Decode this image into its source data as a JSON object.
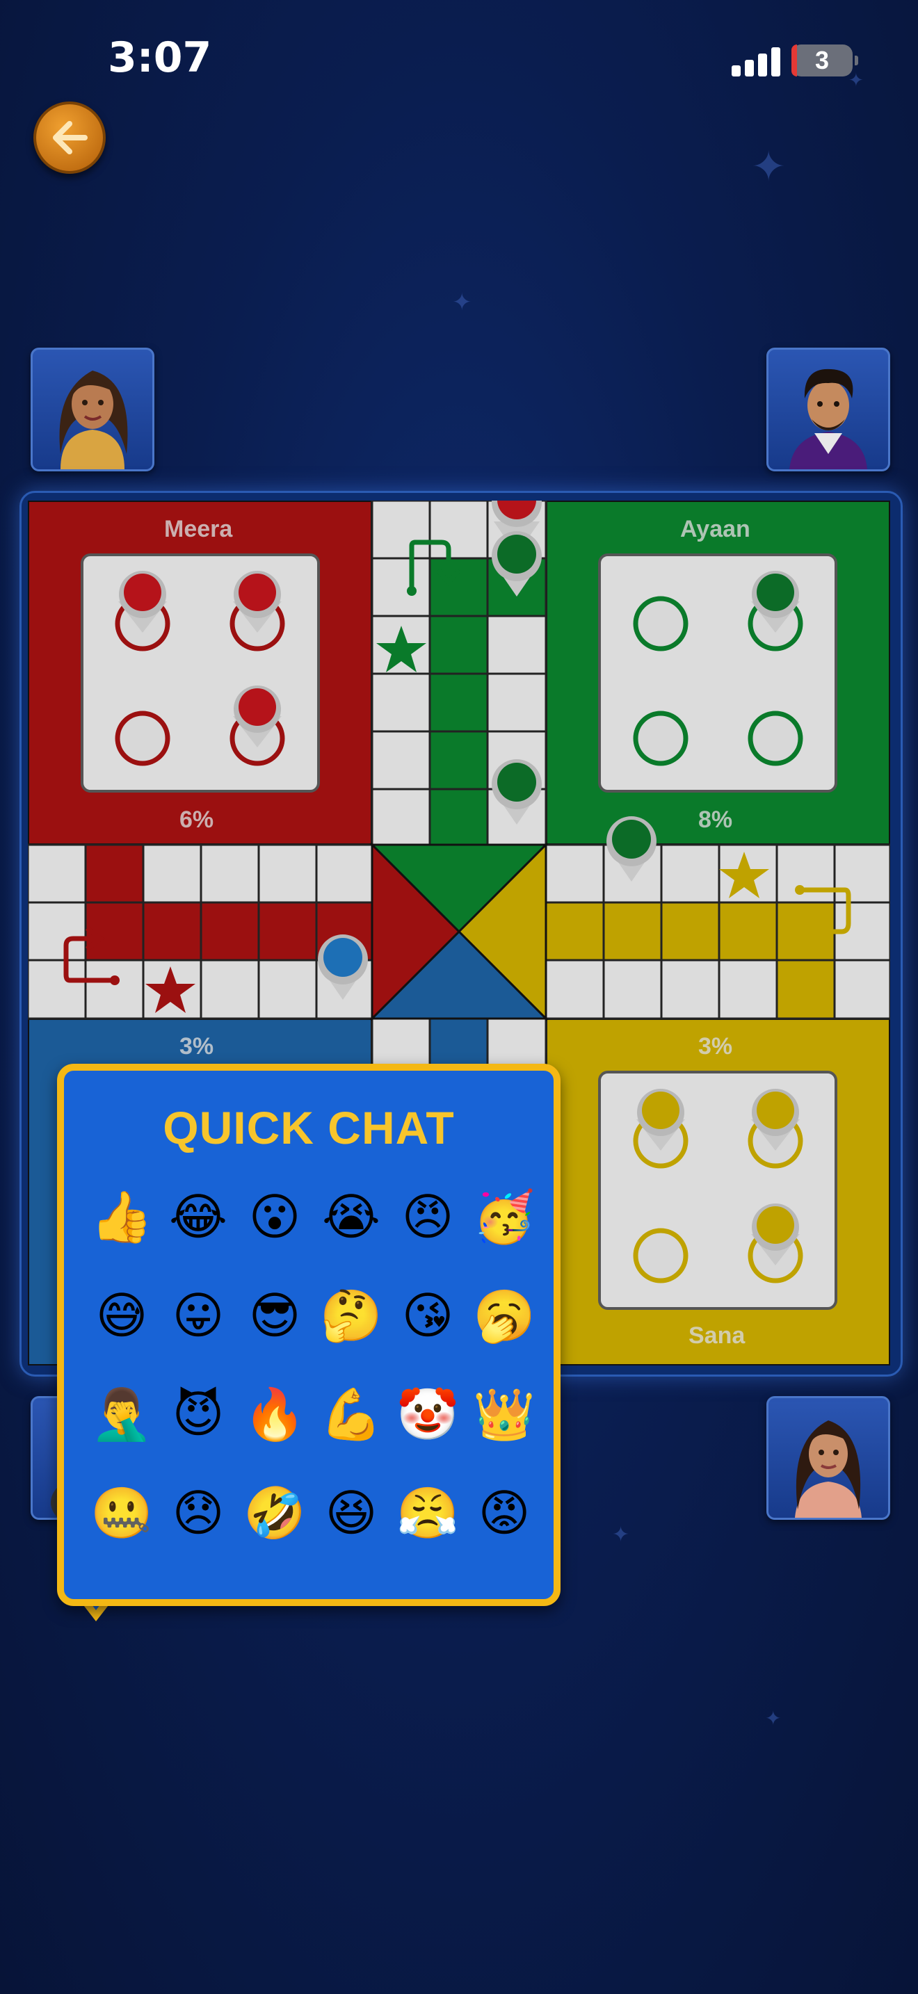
{
  "status_bar": {
    "time": "3:07",
    "battery": "3"
  },
  "players": {
    "red": {
      "name": "Meera",
      "progress": "6%"
    },
    "green": {
      "name": "Ayaan",
      "progress": "8%"
    },
    "blue": {
      "progress": "3%"
    },
    "yellow": {
      "name": "Sana",
      "progress": "3%"
    }
  },
  "colors": {
    "red": "#9b1010",
    "green": "#0a7a2a",
    "yellow": "#bfa200",
    "blue": "#1b5a96",
    "popup_bg": "#1863d6",
    "popup_border": "#f4b814",
    "title": "#f7c52c"
  },
  "icons": {
    "back": "arrow-left-icon",
    "signal": "signal-bars-icon",
    "battery": "battery-icon",
    "star": "safe-star-icon",
    "entry": "entry-arrow-icon"
  },
  "quick_chat": {
    "title": "QUICK CHAT",
    "emojis": [
      "👍",
      "😂",
      "😮",
      "😭",
      "😠",
      "🥳",
      "😅",
      "😛",
      "😎",
      "🤔",
      "😘",
      "🥱",
      "🤦‍♂️",
      "😈",
      "🔥",
      "💪",
      "🤡",
      "👑",
      "🤐",
      "😞",
      "🤣",
      "😆",
      "😤",
      "😡"
    ]
  }
}
